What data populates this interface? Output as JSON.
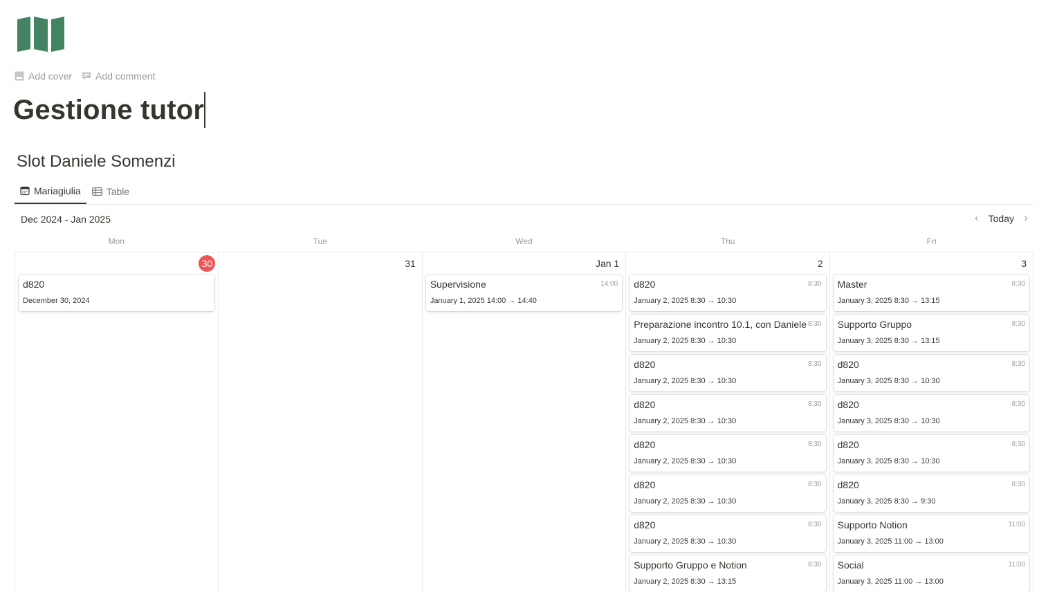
{
  "page": {
    "icon": "map-icon",
    "add_cover": "Add cover",
    "add_comment": "Add comment",
    "title": "Gestione tutor"
  },
  "database": {
    "title": "Slot Daniele Somenzi",
    "views": [
      {
        "label": "Mariagiulia",
        "icon": "calendar-icon",
        "active": true
      },
      {
        "label": "Table",
        "icon": "table-icon",
        "active": false
      }
    ]
  },
  "calendar": {
    "range": "Dec 2024 - Jan 2025",
    "today_label": "Today",
    "weekdays": [
      "Mon",
      "Tue",
      "Wed",
      "Thu",
      "Fri"
    ],
    "colors": {
      "today_badge": "#eb5757",
      "map_icon": "#448361"
    },
    "days": [
      {
        "number": "30",
        "is_today": true,
        "events": [
          {
            "title": "d820",
            "time": "",
            "date": "December 30, 2024"
          }
        ]
      },
      {
        "number": "31",
        "is_today": false,
        "events": []
      },
      {
        "number": "Jan 1",
        "is_today": false,
        "events": [
          {
            "title": "Supervisione",
            "time": "14:00",
            "date": "January 1, 2025 14:00 → 14:40"
          }
        ]
      },
      {
        "number": "2",
        "is_today": false,
        "events": [
          {
            "title": "d820",
            "time": "8:30",
            "date": "January 2, 2025 8:30 → 10:30"
          },
          {
            "title": "Preparazione incontro 10.1, con Daniele",
            "time": "8:30",
            "date": "January 2, 2025 8:30 → 10:30"
          },
          {
            "title": "d820",
            "time": "8:30",
            "date": "January 2, 2025 8:30 → 10:30"
          },
          {
            "title": "d820",
            "time": "8:30",
            "date": "January 2, 2025 8:30 → 10:30"
          },
          {
            "title": "d820",
            "time": "8:30",
            "date": "January 2, 2025 8:30 → 10:30"
          },
          {
            "title": "d820",
            "time": "8:30",
            "date": "January 2, 2025 8:30 → 10:30"
          },
          {
            "title": "d820",
            "time": "8:30",
            "date": "January 2, 2025 8:30 → 10:30"
          },
          {
            "title": "Supporto Gruppo e Notion",
            "time": "8:30",
            "date": "January 2, 2025 8:30 → 13:15"
          }
        ]
      },
      {
        "number": "3",
        "is_today": false,
        "events": [
          {
            "title": "Master",
            "time": "8:30",
            "date": "January 3, 2025 8:30 → 13:15"
          },
          {
            "title": "Supporto Gruppo",
            "time": "8:30",
            "date": "January 3, 2025 8:30 → 13:15"
          },
          {
            "title": "d820",
            "time": "8:30",
            "date": "January 3, 2025 8:30 → 10:30"
          },
          {
            "title": "d820",
            "time": "8:30",
            "date": "January 3, 2025 8:30 → 10:30"
          },
          {
            "title": "d820",
            "time": "8:30",
            "date": "January 3, 2025 8:30 → 10:30"
          },
          {
            "title": "d820",
            "time": "8:30",
            "date": "January 3, 2025 8:30 → 9:30"
          },
          {
            "title": "Supporto Notion",
            "time": "11:00",
            "date": "January 3, 2025 11:00 → 13:00"
          },
          {
            "title": "Social",
            "time": "11:00",
            "date": "January 3, 2025 11:00 → 13:00"
          }
        ]
      }
    ]
  }
}
